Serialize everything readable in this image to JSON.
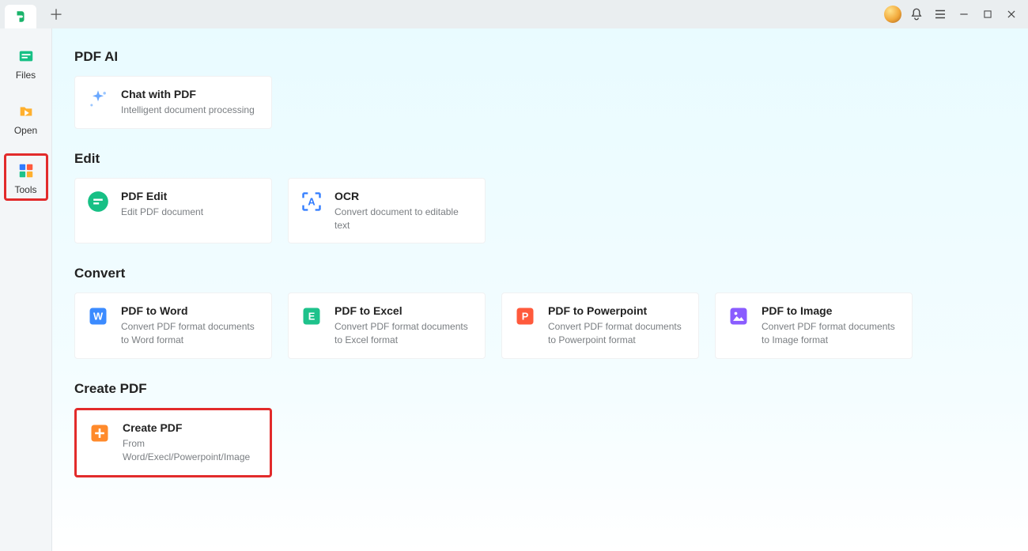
{
  "sidebar": {
    "files": "Files",
    "open": "Open",
    "tools": "Tools"
  },
  "sections": {
    "pdf_ai_title": "PDF AI",
    "edit_title": "Edit",
    "convert_title": "Convert",
    "create_title": "Create PDF"
  },
  "cards": {
    "chat": {
      "title": "Chat with PDF",
      "desc": "Intelligent document processing"
    },
    "pdf_edit": {
      "title": "PDF Edit",
      "desc": "Edit PDF document"
    },
    "ocr": {
      "title": "OCR",
      "desc": "Convert document to editable text"
    },
    "to_word": {
      "title": "PDF to Word",
      "desc": "Convert PDF format documents to Word format"
    },
    "to_excel": {
      "title": "PDF to Excel",
      "desc": "Convert PDF format documents to Excel format"
    },
    "to_ppt": {
      "title": "PDF to Powerpoint",
      "desc": "Convert PDF format documents to Powerpoint format"
    },
    "to_image": {
      "title": "PDF to Image",
      "desc": "Convert PDF format documents to Image format"
    },
    "create": {
      "title": "Create PDF",
      "desc": "From Word/Execl/Powerpoint/Image"
    }
  }
}
